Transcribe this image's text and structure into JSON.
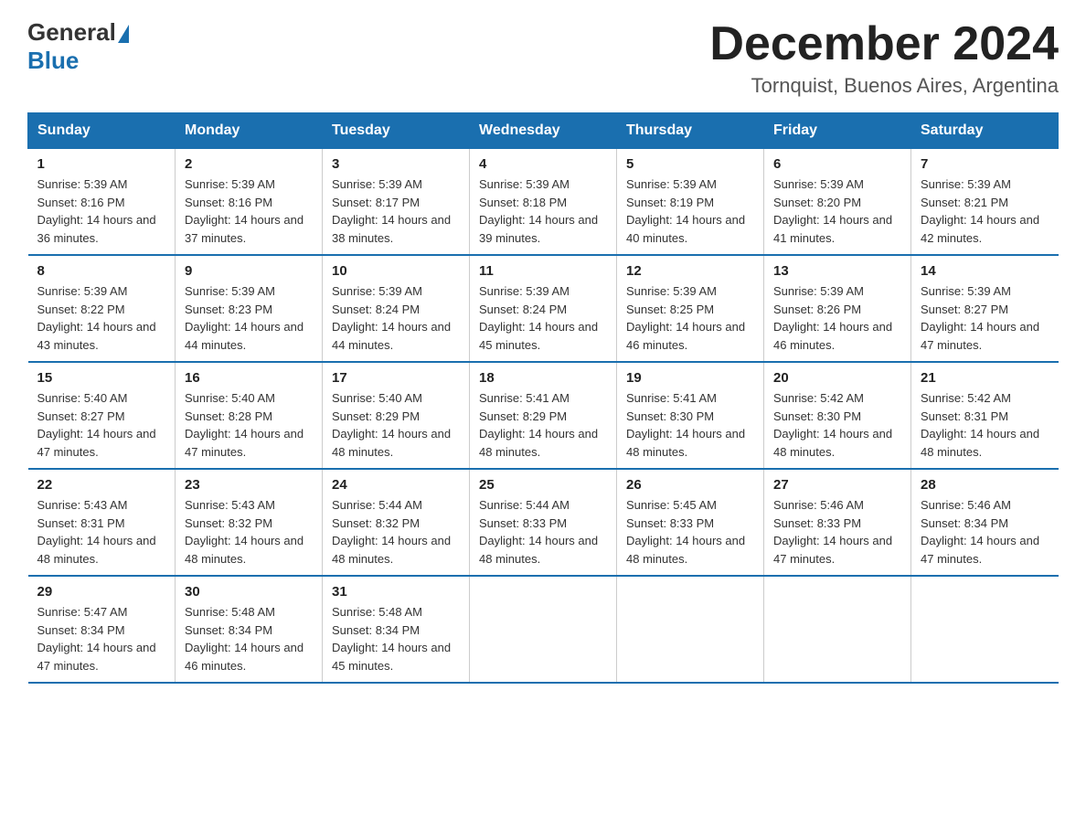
{
  "header": {
    "logo_general": "General",
    "logo_blue": "Blue",
    "month_year": "December 2024",
    "location": "Tornquist, Buenos Aires, Argentina"
  },
  "days_of_week": [
    "Sunday",
    "Monday",
    "Tuesday",
    "Wednesday",
    "Thursday",
    "Friday",
    "Saturday"
  ],
  "weeks": [
    [
      {
        "day": "1",
        "sunrise": "5:39 AM",
        "sunset": "8:16 PM",
        "daylight": "14 hours and 36 minutes."
      },
      {
        "day": "2",
        "sunrise": "5:39 AM",
        "sunset": "8:16 PM",
        "daylight": "14 hours and 37 minutes."
      },
      {
        "day": "3",
        "sunrise": "5:39 AM",
        "sunset": "8:17 PM",
        "daylight": "14 hours and 38 minutes."
      },
      {
        "day": "4",
        "sunrise": "5:39 AM",
        "sunset": "8:18 PM",
        "daylight": "14 hours and 39 minutes."
      },
      {
        "day": "5",
        "sunrise": "5:39 AM",
        "sunset": "8:19 PM",
        "daylight": "14 hours and 40 minutes."
      },
      {
        "day": "6",
        "sunrise": "5:39 AM",
        "sunset": "8:20 PM",
        "daylight": "14 hours and 41 minutes."
      },
      {
        "day": "7",
        "sunrise": "5:39 AM",
        "sunset": "8:21 PM",
        "daylight": "14 hours and 42 minutes."
      }
    ],
    [
      {
        "day": "8",
        "sunrise": "5:39 AM",
        "sunset": "8:22 PM",
        "daylight": "14 hours and 43 minutes."
      },
      {
        "day": "9",
        "sunrise": "5:39 AM",
        "sunset": "8:23 PM",
        "daylight": "14 hours and 44 minutes."
      },
      {
        "day": "10",
        "sunrise": "5:39 AM",
        "sunset": "8:24 PM",
        "daylight": "14 hours and 44 minutes."
      },
      {
        "day": "11",
        "sunrise": "5:39 AM",
        "sunset": "8:24 PM",
        "daylight": "14 hours and 45 minutes."
      },
      {
        "day": "12",
        "sunrise": "5:39 AM",
        "sunset": "8:25 PM",
        "daylight": "14 hours and 46 minutes."
      },
      {
        "day": "13",
        "sunrise": "5:39 AM",
        "sunset": "8:26 PM",
        "daylight": "14 hours and 46 minutes."
      },
      {
        "day": "14",
        "sunrise": "5:39 AM",
        "sunset": "8:27 PM",
        "daylight": "14 hours and 47 minutes."
      }
    ],
    [
      {
        "day": "15",
        "sunrise": "5:40 AM",
        "sunset": "8:27 PM",
        "daylight": "14 hours and 47 minutes."
      },
      {
        "day": "16",
        "sunrise": "5:40 AM",
        "sunset": "8:28 PM",
        "daylight": "14 hours and 47 minutes."
      },
      {
        "day": "17",
        "sunrise": "5:40 AM",
        "sunset": "8:29 PM",
        "daylight": "14 hours and 48 minutes."
      },
      {
        "day": "18",
        "sunrise": "5:41 AM",
        "sunset": "8:29 PM",
        "daylight": "14 hours and 48 minutes."
      },
      {
        "day": "19",
        "sunrise": "5:41 AM",
        "sunset": "8:30 PM",
        "daylight": "14 hours and 48 minutes."
      },
      {
        "day": "20",
        "sunrise": "5:42 AM",
        "sunset": "8:30 PM",
        "daylight": "14 hours and 48 minutes."
      },
      {
        "day": "21",
        "sunrise": "5:42 AM",
        "sunset": "8:31 PM",
        "daylight": "14 hours and 48 minutes."
      }
    ],
    [
      {
        "day": "22",
        "sunrise": "5:43 AM",
        "sunset": "8:31 PM",
        "daylight": "14 hours and 48 minutes."
      },
      {
        "day": "23",
        "sunrise": "5:43 AM",
        "sunset": "8:32 PM",
        "daylight": "14 hours and 48 minutes."
      },
      {
        "day": "24",
        "sunrise": "5:44 AM",
        "sunset": "8:32 PM",
        "daylight": "14 hours and 48 minutes."
      },
      {
        "day": "25",
        "sunrise": "5:44 AM",
        "sunset": "8:33 PM",
        "daylight": "14 hours and 48 minutes."
      },
      {
        "day": "26",
        "sunrise": "5:45 AM",
        "sunset": "8:33 PM",
        "daylight": "14 hours and 48 minutes."
      },
      {
        "day": "27",
        "sunrise": "5:46 AM",
        "sunset": "8:33 PM",
        "daylight": "14 hours and 47 minutes."
      },
      {
        "day": "28",
        "sunrise": "5:46 AM",
        "sunset": "8:34 PM",
        "daylight": "14 hours and 47 minutes."
      }
    ],
    [
      {
        "day": "29",
        "sunrise": "5:47 AM",
        "sunset": "8:34 PM",
        "daylight": "14 hours and 47 minutes."
      },
      {
        "day": "30",
        "sunrise": "5:48 AM",
        "sunset": "8:34 PM",
        "daylight": "14 hours and 46 minutes."
      },
      {
        "day": "31",
        "sunrise": "5:48 AM",
        "sunset": "8:34 PM",
        "daylight": "14 hours and 45 minutes."
      },
      null,
      null,
      null,
      null
    ]
  ],
  "labels": {
    "sunrise": "Sunrise:",
    "sunset": "Sunset:",
    "daylight": "Daylight:"
  }
}
